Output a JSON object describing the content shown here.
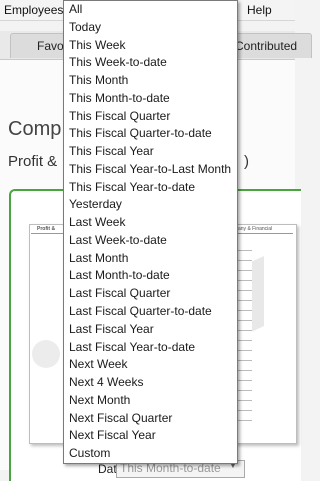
{
  "menubar": {
    "items": [
      "Employees",
      "Help"
    ]
  },
  "tabs": [
    "Favo",
    "Contributed"
  ],
  "page": {
    "title": "Comp",
    "subtitle_left": "Profit &",
    "subtitle_right": ")"
  },
  "report_preview": {
    "header_left": "Profit &",
    "header_right": "any & Financial"
  },
  "dates": {
    "label": "Dates:",
    "selected": "This Month-to-date"
  },
  "dropdown": {
    "options": [
      "All",
      "Today",
      "This Week",
      "This Week-to-date",
      "This Month",
      "This Month-to-date",
      "This Fiscal Quarter",
      "This Fiscal Quarter-to-date",
      "This Fiscal Year",
      "This Fiscal Year-to-Last Month",
      "This Fiscal Year-to-date",
      "Yesterday",
      "Last Week",
      "Last Week-to-date",
      "Last Month",
      "Last Month-to-date",
      "Last Fiscal Quarter",
      "Last Fiscal Quarter-to-date",
      "Last Fiscal Year",
      "Last Fiscal Year-to-date",
      "Next Week",
      "Next 4 Weeks",
      "Next Month",
      "Next Fiscal Quarter",
      "Next Fiscal Year",
      "Custom"
    ]
  }
}
